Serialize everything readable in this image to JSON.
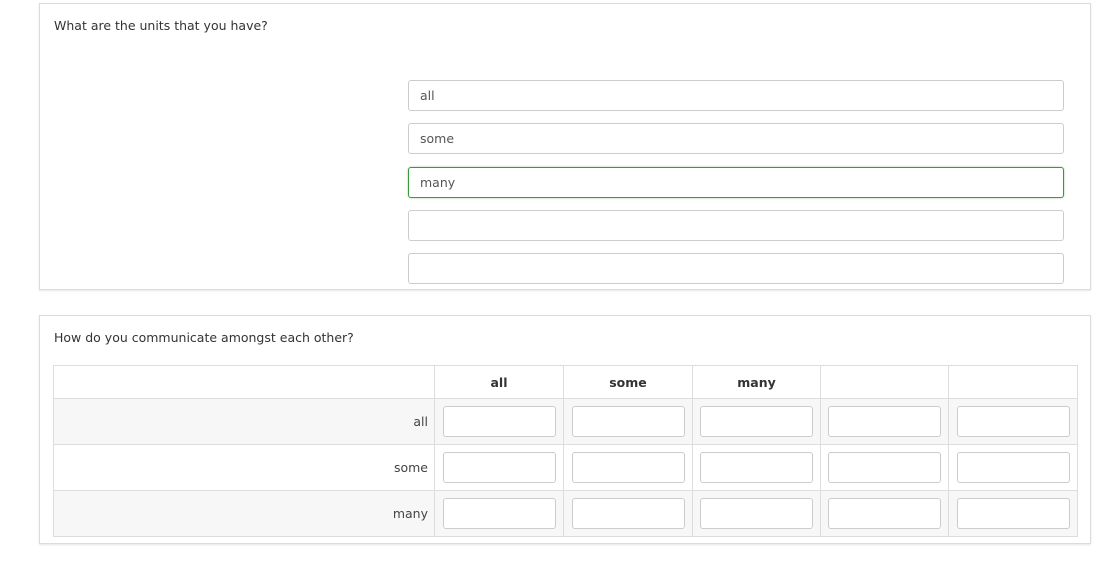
{
  "question1": {
    "text": "What are the units that you have?",
    "inputs": [
      {
        "value": "all"
      },
      {
        "value": "some"
      },
      {
        "value": "many"
      },
      {
        "value": ""
      },
      {
        "value": ""
      }
    ]
  },
  "question2": {
    "text": "How do you communicate amongst each other?",
    "columns": [
      "all",
      "some",
      "many",
      "",
      ""
    ],
    "rows": [
      "all",
      "some",
      "many"
    ]
  }
}
